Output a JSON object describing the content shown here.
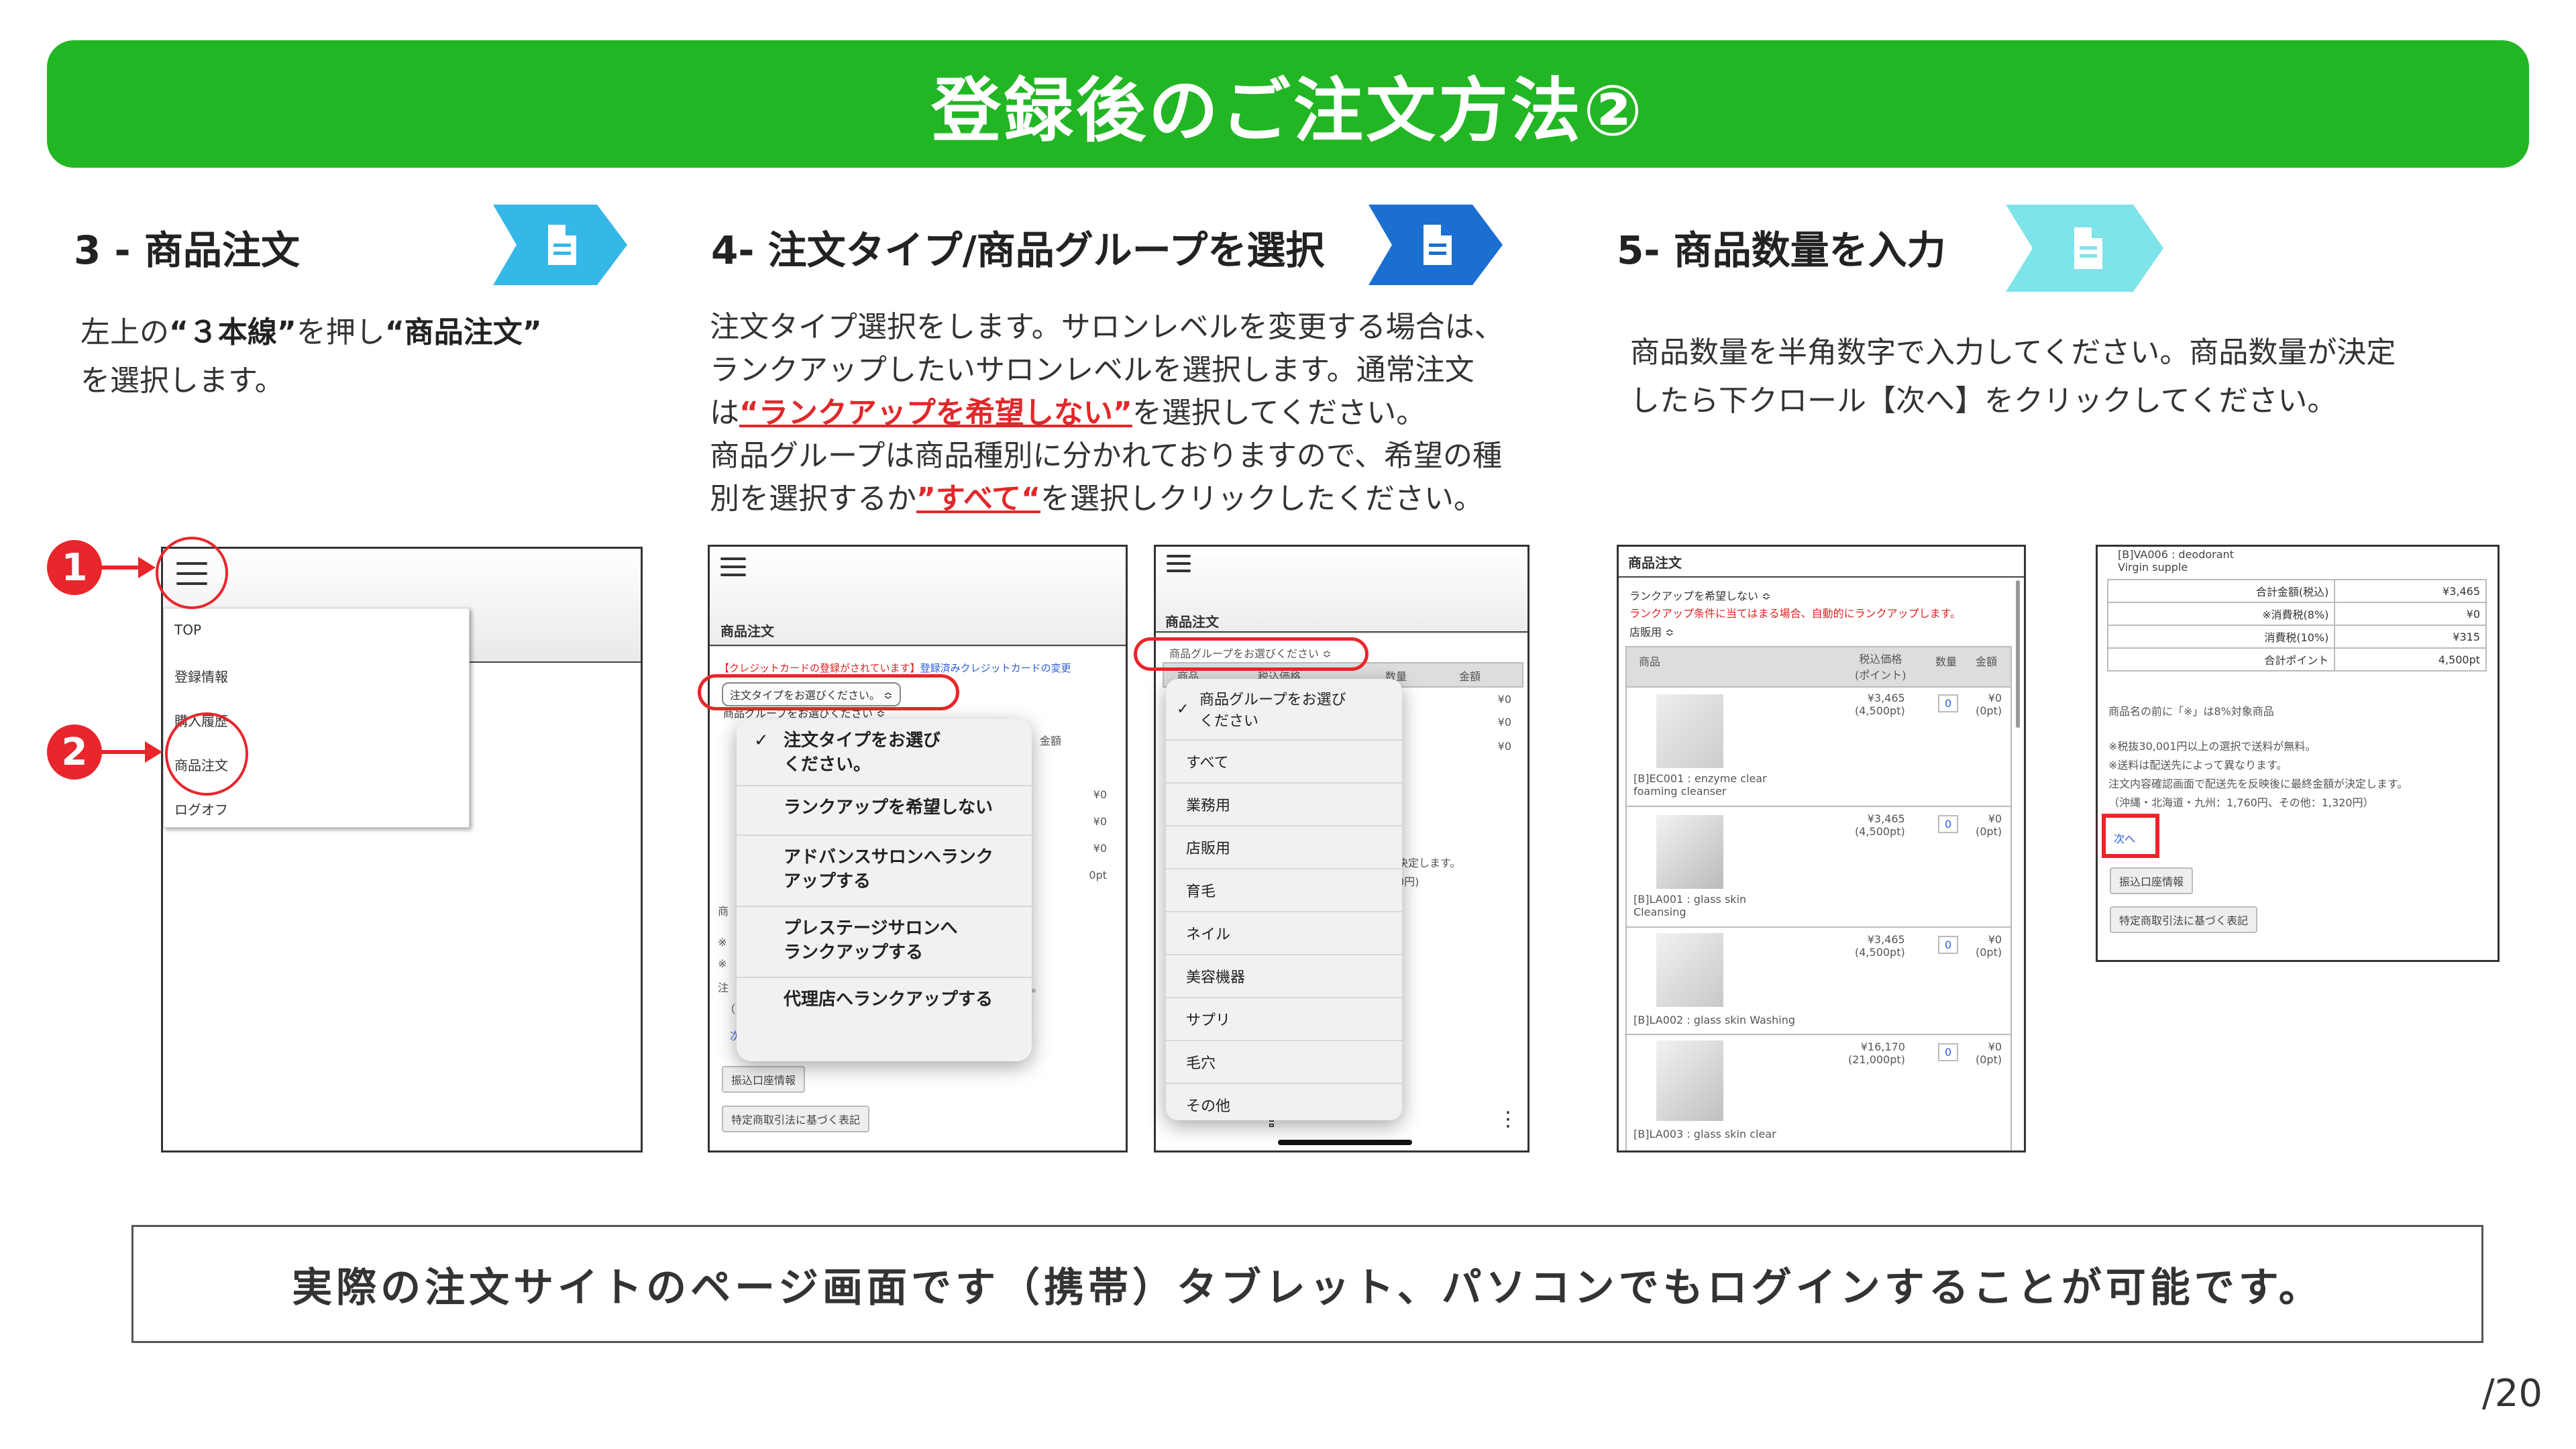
{
  "banner": {
    "title": "登録後のご注文方法②"
  },
  "steps": [
    {
      "title": "3 - 商品注文",
      "chevron_color": "#35b7e8",
      "desc_lines": [
        [
          "左上の",
          "“３本線”",
          "を押し",
          "“商品注文”"
        ],
        [
          "を選択します。"
        ]
      ]
    },
    {
      "title": "4- 注文タイプ/商品グループを選択",
      "chevron_color": "#1a6fd0",
      "desc_lines": [
        "注文タイプ選択をします。サロンレベルを変更する場合は、",
        "ランクアップしたいサロンレベルを選択します。通常注文",
        [
          "は",
          "“ランクアップを希望しない”",
          "を選択してください。"
        ],
        "商品グループは商品種別に分かれておりますので、希望の種",
        [
          "別を選択するか",
          "”すべて“",
          "を選択しクリックしたください。"
        ]
      ]
    },
    {
      "title": "5- 商品数量を入力",
      "chevron_color": "#7fe3ea",
      "desc_lines": [
        "商品数量を半角数字で入力してください。商品数量が決定",
        "したら下クロール【次へ】をクリックしてください。"
      ]
    }
  ],
  "markers": {
    "one": "1",
    "two": "2"
  },
  "s1": {
    "menu": [
      "TOP",
      "登録情報",
      "購入履歴",
      "商品注文",
      "ログオフ"
    ]
  },
  "s2": {
    "page_title": "商品注文",
    "card_msg": "【クレジットカードの登録がされています】",
    "card_link": "登録済みクレジットカードの変更",
    "select1": "注文タイプをお選びください。 ≎",
    "select2": "商品グループをお選びください ≎",
    "col_amount": "金額",
    "zeros": [
      "¥0",
      "¥0",
      "¥0",
      "0pt"
    ],
    "menu": [
      "注文タイプをお選び\nください。",
      "ランクアップを希望しない",
      "アドバンスサロンへランク\nアップする",
      "プレステージサロンへ\nランクアップする",
      "代理店へランクアップする"
    ],
    "fragments": [
      "商",
      "※",
      "※",
      "注",
      "（",
      "C",
      "o。",
      "次"
    ],
    "btn1": "振込口座情報",
    "btn2": "特定商取引法に基づく表記"
  },
  "s3": {
    "page_title": "商品注文",
    "select": "商品グループをお選びください ≎",
    "cols": [
      "商品",
      "税込価格",
      "数量",
      "金額"
    ],
    "zeros": [
      "¥0",
      "¥0",
      "¥0"
    ],
    "frag1": "決定します。",
    "frag2": "0円)",
    "list": [
      "商品グループをお選び\nください",
      "すべて",
      "業務用",
      "店販用",
      "育毛",
      "ネイル",
      "美容機器",
      "サプリ",
      "毛穴",
      "その他"
    ],
    "share_icon": "share-icon",
    "more_icon": "more-icon"
  },
  "s4": {
    "page_title": "商品注文",
    "select1": "ランクアップを希望しない ≎",
    "notice": "ランクアップ条件に当てはまる場合、自動的にランクアップします。",
    "select2": "店販用 ≎",
    "cols": [
      "商品",
      "税込価格\n(ポイント)",
      "数量",
      "金額"
    ],
    "rows": [
      {
        "name": "[B]EC001 : enzyme clear\nfoaming cleanser",
        "price": "¥3,465\n(4,500pt)",
        "qty": "0",
        "amt": "¥0\n(0pt)"
      },
      {
        "name": "[B]LA001 : glass skin\nCleansing",
        "price": "¥3,465\n(4,500pt)",
        "qty": "0",
        "amt": "¥0\n(0pt)"
      },
      {
        "name": "[B]LA002 : glass skin Washing",
        "price": "¥3,465\n(4,500pt)",
        "qty": "0",
        "amt": "¥0\n(0pt)"
      },
      {
        "name": "[B]LA003 : glass skin clear",
        "price": "¥16,170\n(21,000pt)",
        "qty": "0",
        "amt": "¥0\n(0pt)"
      }
    ]
  },
  "s5": {
    "top_item": "[B]VA006 : deodorant\nVirgin supple",
    "totals": [
      [
        "合計金額(税込)",
        "¥3,465"
      ],
      [
        "※消費税(8%)",
        "¥0"
      ],
      [
        "消費税(10%)",
        "¥315"
      ],
      [
        "合計ポイント",
        "4,500pt"
      ]
    ],
    "note1": "商品名の前に「※」は8%対象商品",
    "note2": "※税抜30,001円以上の選択で送料が無料。",
    "note3": "※送料は配送先によって異なります。",
    "note4": "注文内容確認画面で配送先を反映後に最終金額が決定します。",
    "note5": "（沖縄・北海道・九州：1,760円、その他：1,320円）",
    "next": "次へ",
    "btn1": "振込口座情報",
    "btn2": "特定商取引法に基づく表記"
  },
  "bottom_note": "実際の注文サイトのページ画面です（携帯）タブレット、パソコンでもログインすることが可能です。",
  "page_number": "/20"
}
